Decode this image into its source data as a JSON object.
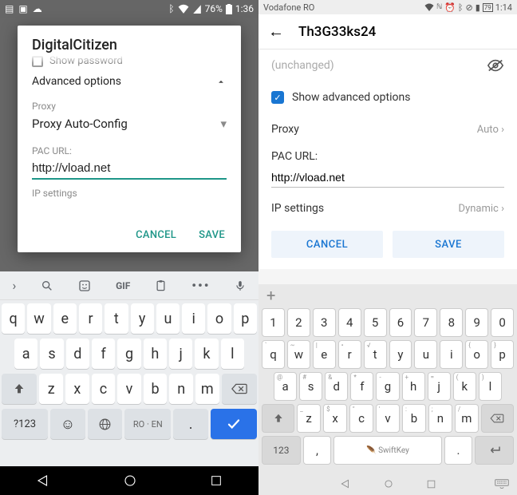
{
  "left": {
    "status": {
      "battery": "76%",
      "time": "1:36"
    },
    "dialog": {
      "title": "DigitalCitizen",
      "show_password": "Show password",
      "advanced": "Advanced options",
      "proxy_label": "Proxy",
      "proxy_value": "Proxy Auto-Config",
      "pac_url_label": "PAC URL:",
      "pac_url_value": "http://vload.net",
      "ip_label": "IP settings",
      "cancel": "CANCEL",
      "save": "SAVE"
    },
    "keyboard": {
      "gif": "GIF",
      "rows": [
        [
          "q",
          "w",
          "e",
          "r",
          "t",
          "y",
          "u",
          "i",
          "o",
          "p"
        ],
        [
          "a",
          "s",
          "d",
          "f",
          "g",
          "h",
          "j",
          "k",
          "l"
        ],
        [
          "z",
          "x",
          "c",
          "v",
          "b",
          "n",
          "m"
        ]
      ],
      "sym": "?123",
      "space": "RO · EN",
      "period": "."
    }
  },
  "right": {
    "status": {
      "carrier": "Vodafone RO",
      "time": "1:14",
      "battery": "79"
    },
    "title": "Th3G33ks24",
    "body": {
      "unchanged": "(unchanged)",
      "show_adv": "Show advanced options",
      "proxy_label": "Proxy",
      "proxy_value": "Auto",
      "pac_url_label": "PAC URL:",
      "pac_url_value": "http://vload.net",
      "ip_label": "IP settings",
      "ip_value": "Dynamic",
      "cancel": "CANCEL",
      "save": "SAVE"
    },
    "keyboard": {
      "rows": {
        "num": [
          "1",
          "2",
          "3",
          "4",
          "5",
          "6",
          "7",
          "8",
          "9",
          "0"
        ],
        "r1": [
          [
            "`",
            "q"
          ],
          [
            "~",
            "w"
          ],
          [
            "|",
            "e"
          ],
          [
            "•",
            "r"
          ],
          [
            "√",
            "t"
          ],
          [
            "",
            "y"
          ],
          [
            "",
            "u"
          ],
          [
            "",
            "i"
          ],
          [
            "{",
            "o"
          ],
          [
            "}",
            "p"
          ]
        ],
        "r2": [
          [
            "@",
            "a"
          ],
          [
            "#",
            "s"
          ],
          [
            "&",
            "d"
          ],
          [
            "*",
            "f"
          ],
          [
            "-",
            "g"
          ],
          [
            "+",
            "h"
          ],
          [
            "=",
            "j"
          ],
          [
            "(",
            "k"
          ],
          [
            ")",
            "l"
          ]
        ],
        "r3": [
          [
            "_",
            "z"
          ],
          [
            "$",
            "x"
          ],
          [
            "\"",
            "c"
          ],
          [
            "'",
            "v"
          ],
          [
            ":",
            "b"
          ],
          [
            ";",
            "n"
          ],
          [
            "/",
            "m"
          ]
        ]
      },
      "sym": "123",
      "comma": ",",
      "space": "SwiftKey",
      "period": "."
    }
  }
}
